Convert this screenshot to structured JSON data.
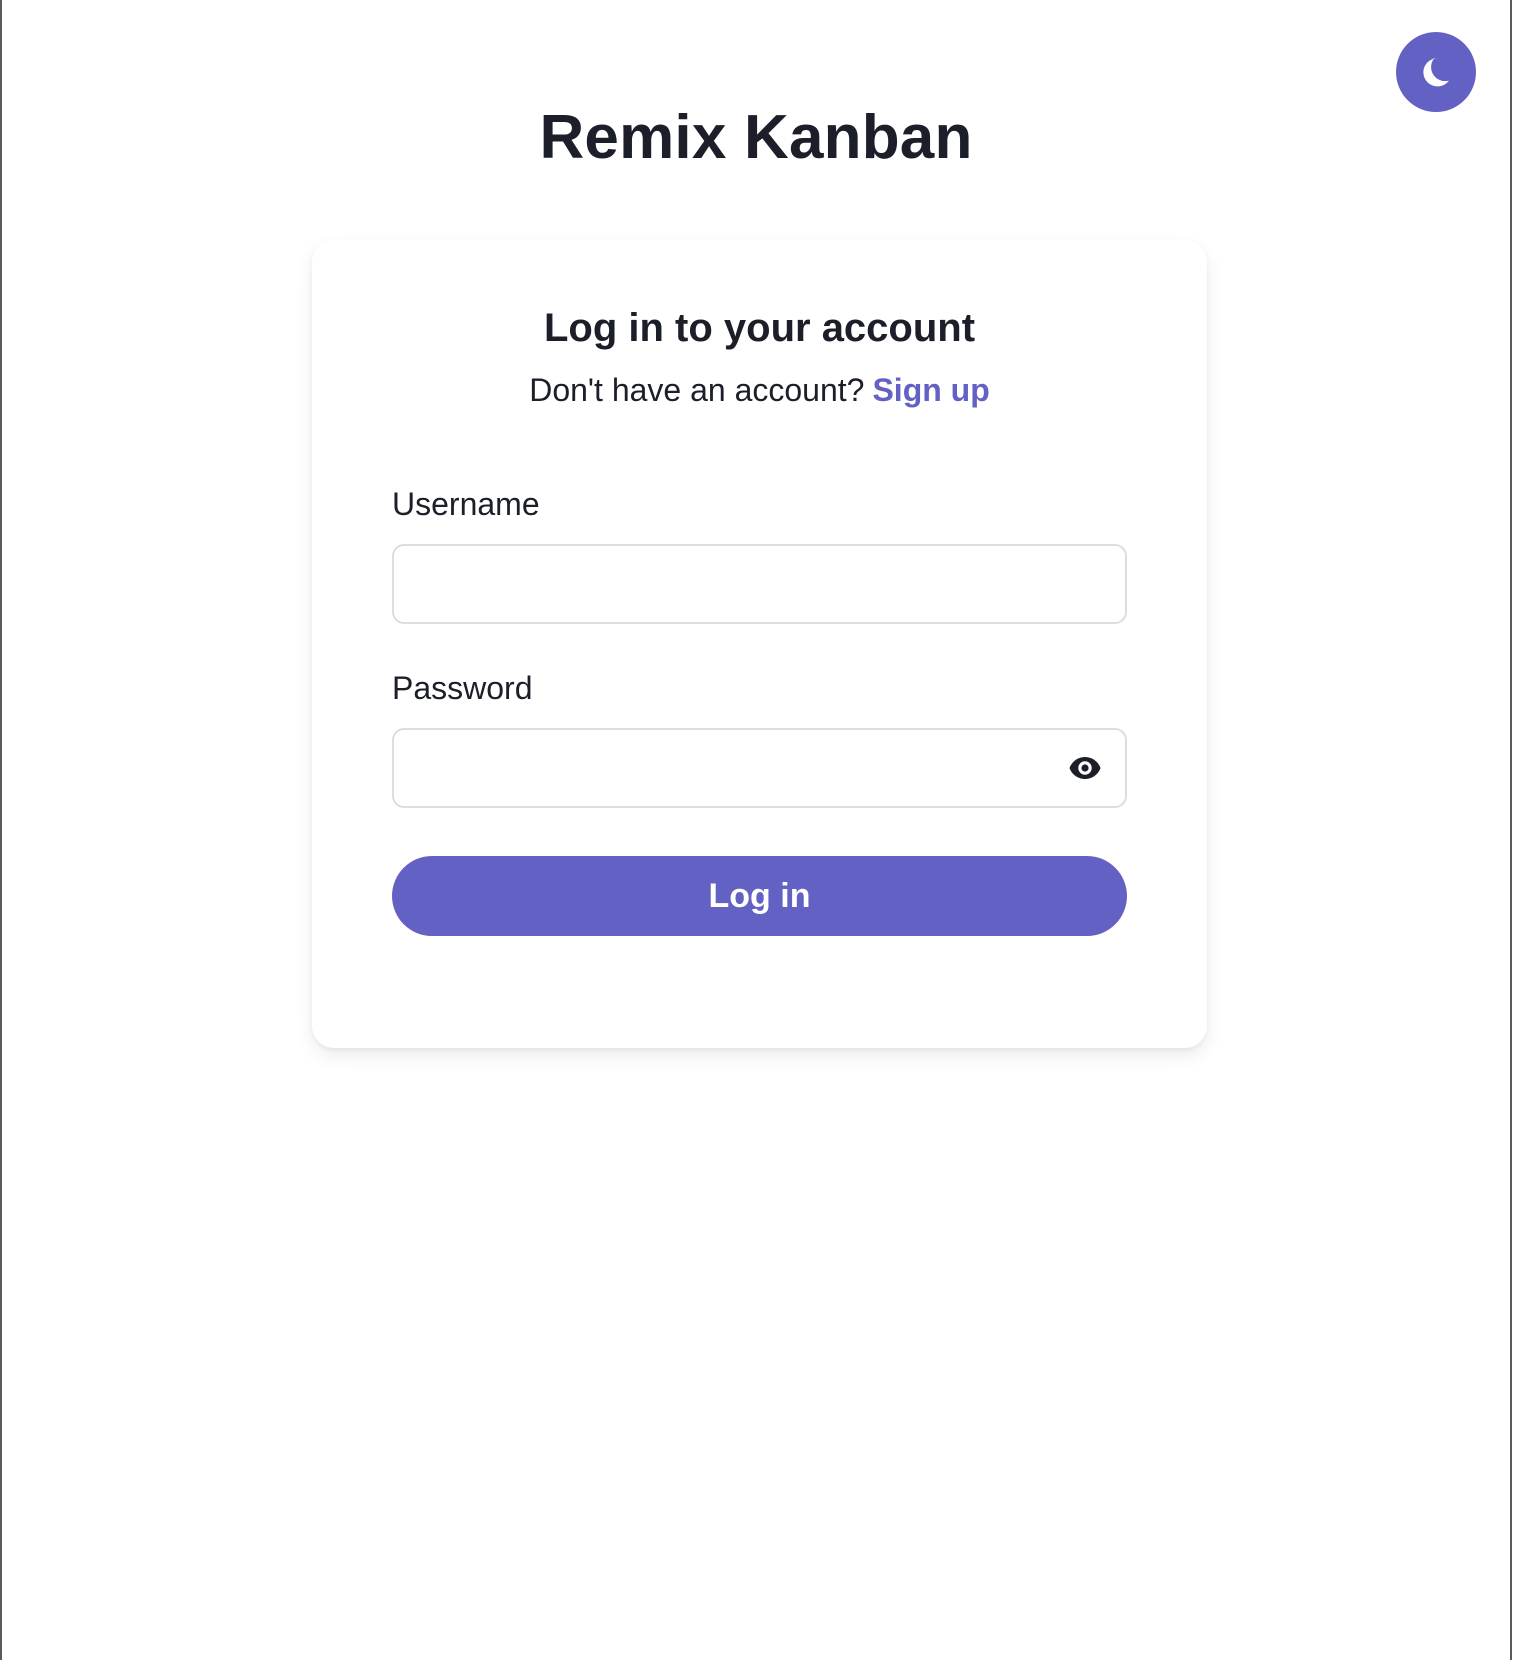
{
  "app": {
    "title": "Remix Kanban"
  },
  "theme_toggle": {
    "icon": "moon-icon"
  },
  "login_card": {
    "heading": "Log in to your account",
    "signup_prompt": "Don't have an account?",
    "signup_link": "Sign up",
    "username_label": "Username",
    "username_value": "",
    "password_label": "Password",
    "password_value": "",
    "password_toggle_icon": "eye-icon",
    "submit_label": "Log in"
  },
  "colors": {
    "accent": "#6361c4",
    "text": "#1c1f2a",
    "input_border": "#dcdde4",
    "background": "#ffffff"
  }
}
